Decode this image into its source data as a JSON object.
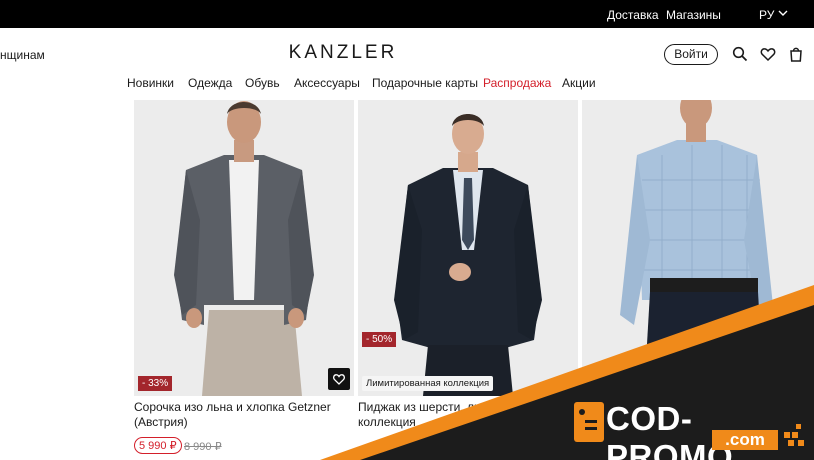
{
  "topbar": {
    "delivery": "Доставка",
    "stores": "Магазины",
    "lang": "РУ"
  },
  "header": {
    "women_link": "нщинам",
    "logo": "KANZLER",
    "login": "Войти"
  },
  "nav": {
    "items": [
      "Новинки",
      "Одежда",
      "Обувь",
      "Аксессуары",
      "Подарочные карты",
      "Распродажа",
      "Акции"
    ]
  },
  "products": [
    {
      "badge": "- 33%",
      "name_line1": "Сорочка изо льна и хлопка Getzner",
      "name_line2": "(Австрия)",
      "price": "5 990 ₽",
      "old_price": "8 990 ₽"
    },
    {
      "badge": "- 50%",
      "label": "Лимитированная коллекция",
      "name_line1": "Пиджак из шерсти, лим",
      "name_line2": "коллекция"
    },
    {}
  ],
  "promo": {
    "brand": "COD-PROMO",
    "domain": ".com",
    "colors": {
      "dark": "#1c1c1c",
      "orange": "#f08a1a"
    }
  }
}
